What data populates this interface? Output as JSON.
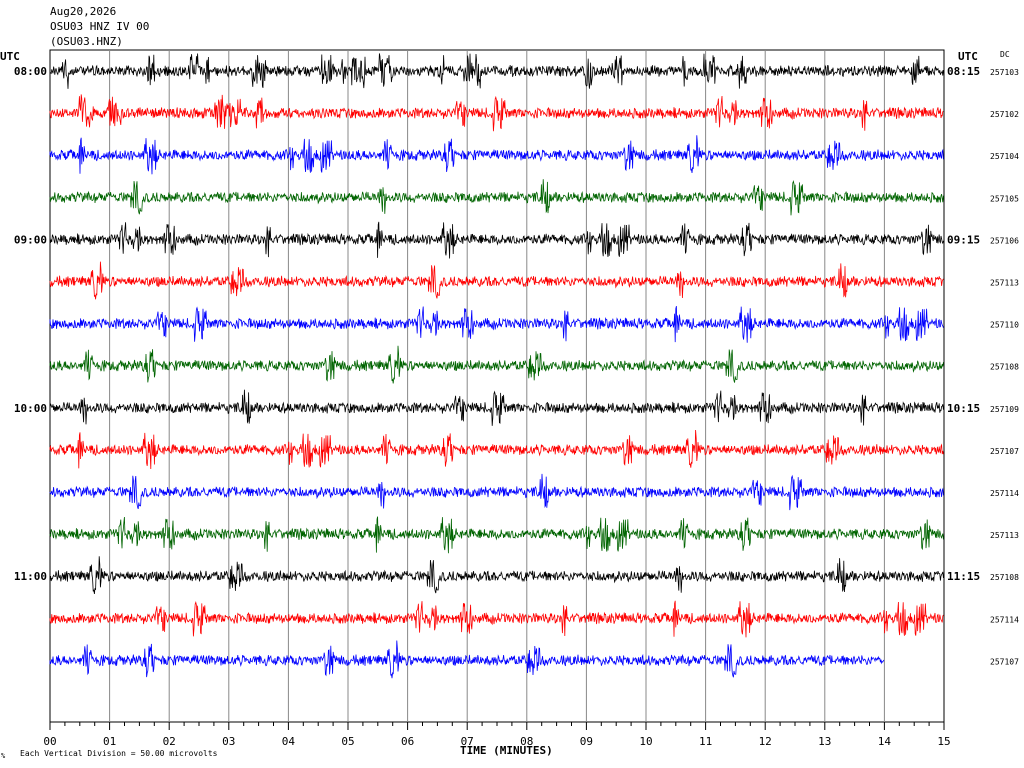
{
  "header": {
    "date": "Aug20,2026",
    "station": "OSU03 HNZ IV 00",
    "channel": "(OSU03.HNZ)"
  },
  "utc_left": "UTC",
  "utc_right": "UTC",
  "dc_label": "DC",
  "footer": {
    "scale_note": "Each Vertical Division =   50.00 microvolts",
    "corner_mark": "%"
  },
  "chart_data": {
    "type": "line",
    "title": "",
    "xlabel": "TIME (MINUTES)",
    "ylabel": "",
    "xlim": [
      0,
      15
    ],
    "x_ticks": [
      "00",
      "01",
      "02",
      "03",
      "04",
      "05",
      "06",
      "07",
      "08",
      "09",
      "10",
      "11",
      "12",
      "13",
      "14",
      "15"
    ],
    "grid": true,
    "left_time_labels": [
      "08:00",
      "09:00",
      "10:00",
      "11:00"
    ],
    "right_time_labels": [
      "08:15",
      "09:15",
      "10:15",
      "11:15"
    ],
    "trace_colors": [
      "#000000",
      "#ff0000",
      "#0000ff",
      "#006400"
    ],
    "traces": [
      {
        "dc": "257103",
        "end_minute": 15
      },
      {
        "dc": "257102",
        "end_minute": 15
      },
      {
        "dc": "257104",
        "end_minute": 15
      },
      {
        "dc": "257105",
        "end_minute": 15
      },
      {
        "dc": "257106",
        "end_minute": 15
      },
      {
        "dc": "257113",
        "end_minute": 15
      },
      {
        "dc": "257110",
        "end_minute": 15
      },
      {
        "dc": "257108",
        "end_minute": 15
      },
      {
        "dc": "257109",
        "end_minute": 15
      },
      {
        "dc": "257107",
        "end_minute": 15
      },
      {
        "dc": "257114",
        "end_minute": 15
      },
      {
        "dc": "257113",
        "end_minute": 15
      },
      {
        "dc": "257108",
        "end_minute": 15
      },
      {
        "dc": "257114",
        "end_minute": 15
      },
      {
        "dc": "257107",
        "end_minute": 14
      }
    ]
  }
}
